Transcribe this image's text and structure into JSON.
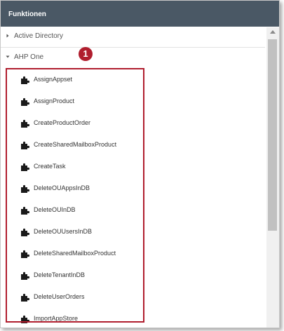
{
  "panel": {
    "title": "Funktionen",
    "badge": "1"
  },
  "groups": [
    {
      "label": "Active Directory",
      "expanded": false
    },
    {
      "label": "AHP One",
      "expanded": true
    }
  ],
  "items": [
    {
      "label": "AssignAppset"
    },
    {
      "label": "AssignProduct"
    },
    {
      "label": "CreateProductOrder"
    },
    {
      "label": "CreateSharedMailboxProduct"
    },
    {
      "label": "CreateTask"
    },
    {
      "label": "DeleteOUAppsInDB"
    },
    {
      "label": "DeleteOUInDB"
    },
    {
      "label": "DeleteOUUsersInDB"
    },
    {
      "label": "DeleteSharedMailboxProduct"
    },
    {
      "label": "DeleteTenantInDB"
    },
    {
      "label": "DeleteUserOrders"
    },
    {
      "label": "ImportAppStore"
    }
  ],
  "colors": {
    "header_bg": "#4a5865",
    "highlight": "#b01e2e",
    "icon": "#1a1a1a"
  },
  "icons": {
    "collapsed": "chevron-right-icon",
    "expanded": "chevron-down-icon",
    "item": "puzzle-piece-icon"
  }
}
